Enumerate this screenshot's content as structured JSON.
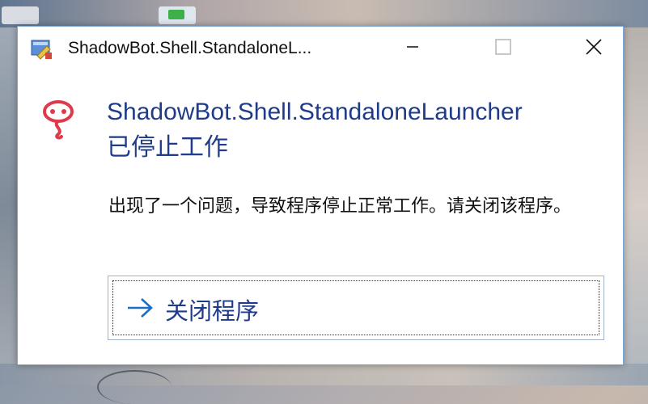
{
  "dialog": {
    "title": "ShadowBot.Shell.StandaloneL...",
    "heading_line1": "ShadowBot.Shell.StandaloneLauncher",
    "heading_line2": "已停止工作",
    "description": "出现了一个问题，导致程序停止正常工作。请关闭该程序。",
    "close_program_label": "关闭程序"
  },
  "colors": {
    "heading": "#1f3b8a",
    "error_icon": "#e0394b",
    "window_border": "#7aa6d6"
  },
  "icons": {
    "app": "app-icon",
    "error": "error-icon",
    "arrow": "arrow-right-icon",
    "minimize": "minimize-icon",
    "maximize": "maximize-icon",
    "close": "close-icon"
  }
}
